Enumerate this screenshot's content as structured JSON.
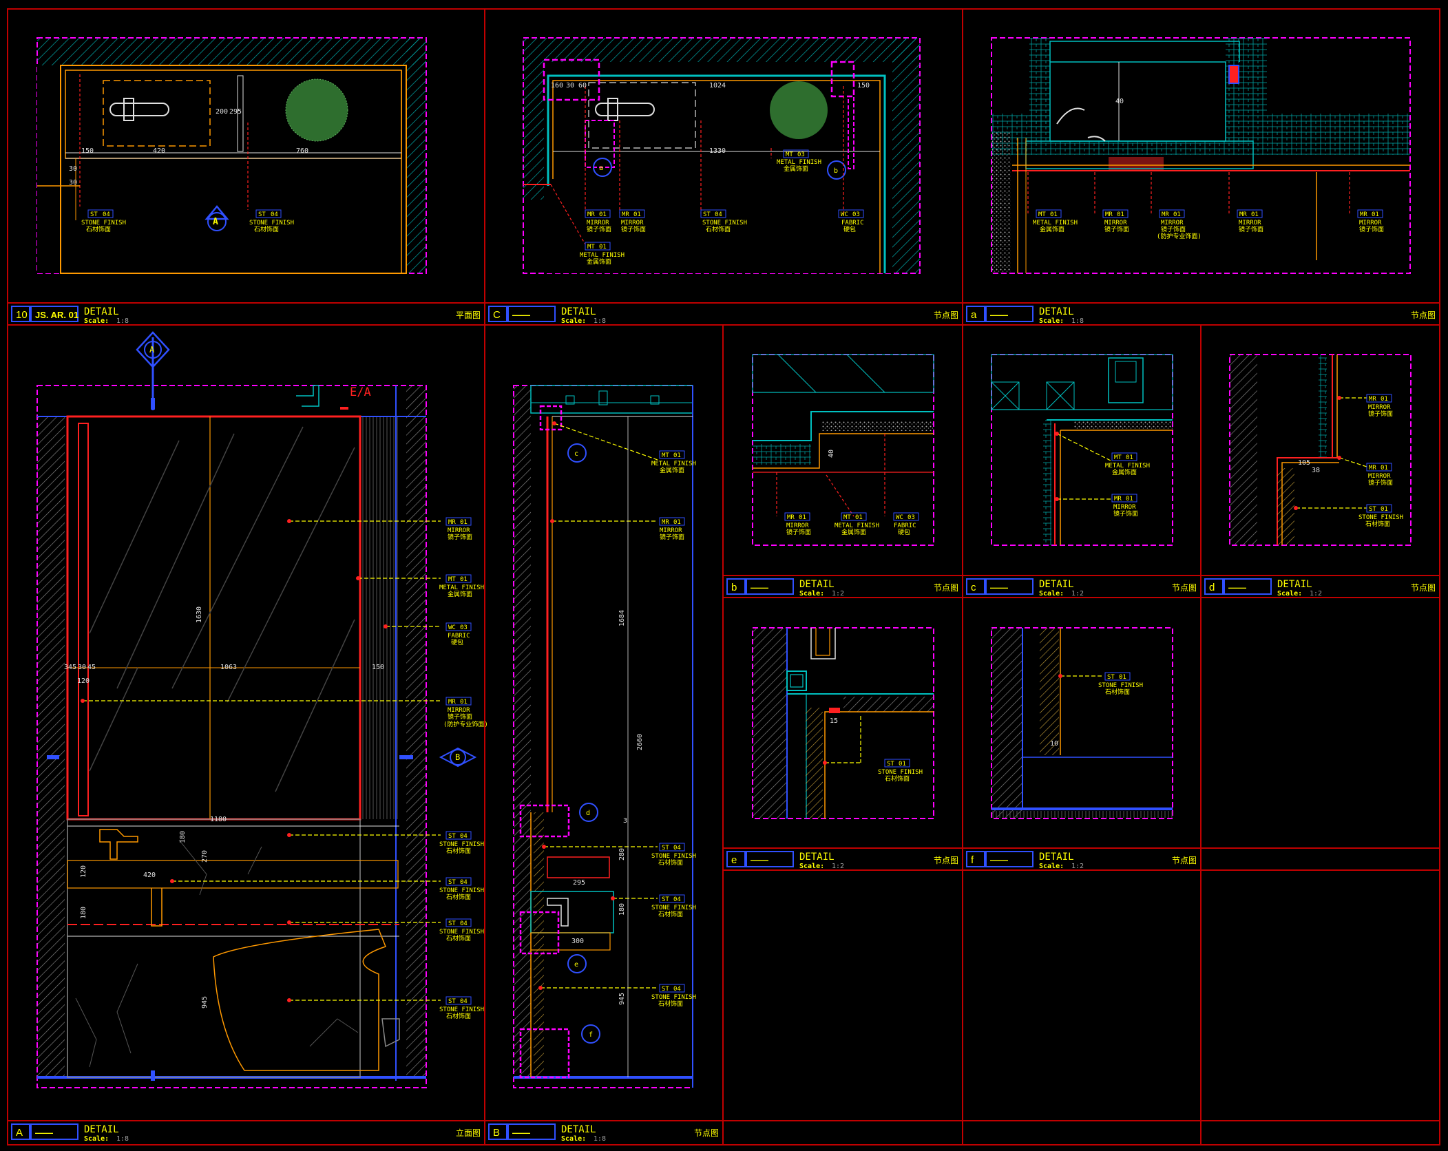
{
  "colors": {
    "frame": "#c00000",
    "magenta": "#ff00ff",
    "yellow": "#ffff00",
    "orange": "#ff9900",
    "cyan": "#00c0c0",
    "blue": "#3050ff",
    "red": "#ff2020",
    "green": "#3a8a3a",
    "white": "#e0e0e0",
    "grey": "#707070"
  },
  "title_blocks": [
    {
      "id": "10",
      "ref": "JS. AR. 01",
      "title": "DETAIL",
      "scale_prefix": "Scale:",
      "scale": "1:8",
      "type": "平面图"
    },
    {
      "id": "C",
      "ref": "——",
      "title": "DETAIL",
      "scale_prefix": "Scale:",
      "scale": "1:8",
      "type": "节点图"
    },
    {
      "id": "a",
      "ref": "——",
      "title": "DETAIL",
      "scale_prefix": "Scale:",
      "scale": "1:8",
      "type": "节点图"
    },
    {
      "id": "A",
      "ref": "——",
      "title": "DETAIL",
      "scale_prefix": "Scale:",
      "scale": "1:8",
      "type": "立面图"
    },
    {
      "id": "B",
      "ref": "——",
      "title": "DETAIL",
      "scale_prefix": "Scale:",
      "scale": "1:8",
      "type": "节点图"
    },
    {
      "id": "b",
      "ref": "——",
      "title": "DETAIL",
      "scale_prefix": "Scale:",
      "scale": "1:2",
      "type": "节点图"
    },
    {
      "id": "c",
      "ref": "——",
      "title": "DETAIL",
      "scale_prefix": "Scale:",
      "scale": "1:2",
      "type": "节点图"
    },
    {
      "id": "d",
      "ref": "——",
      "title": "DETAIL",
      "scale_prefix": "Scale:",
      "scale": "1:2",
      "type": "节点图"
    },
    {
      "id": "e",
      "ref": "——",
      "title": "DETAIL",
      "scale_prefix": "Scale:",
      "scale": "1:2",
      "type": "节点图"
    },
    {
      "id": "f",
      "ref": "——",
      "title": "DETAIL",
      "scale_prefix": "Scale:",
      "scale": "1:2",
      "type": "节点图"
    }
  ],
  "materials": {
    "st04": {
      "code": "ST",
      "num": "04",
      "en": "STONE FINISH",
      "cn": "石材饰面"
    },
    "st01": {
      "code": "ST",
      "num": "01",
      "en": "STONE FINISH",
      "cn": "石材饰面"
    },
    "mr01": {
      "code": "MR",
      "num": "01",
      "en": "MIRROR",
      "cn": "镜子饰面"
    },
    "mr01b": {
      "code": "MR",
      "num": "01",
      "en": "MIRROR",
      "cn": "镜子饰面",
      "note": "(防护专业饰面)"
    },
    "mt01": {
      "code": "MT",
      "num": "01",
      "en": "METAL FINISH",
      "cn": "金属饰面"
    },
    "mt03": {
      "code": "MT",
      "num": "03",
      "en": "METAL FINISH",
      "cn": "金属饰面"
    },
    "wc03": {
      "code": "WC",
      "num": "03",
      "en": "FABRIC",
      "cn": "硬包"
    }
  },
  "markers": {
    "section_A": "A",
    "section_B": "B",
    "elev_ea": "E/A",
    "callouts": [
      "a",
      "b",
      "c",
      "d",
      "e",
      "f"
    ]
  },
  "dims": {
    "p1": [
      "150",
      "420",
      "760",
      "30",
      "295",
      "200",
      "30"
    ],
    "p2": [
      "1024",
      "1330",
      "160",
      "30",
      "60",
      "150"
    ],
    "pa": [
      "40"
    ],
    "pA": [
      "1630",
      "1063",
      "345",
      "30",
      "45",
      "150",
      "120",
      "420",
      "180",
      "180",
      "120",
      "945",
      "1180",
      "270"
    ],
    "pB": [
      "1684",
      "2660",
      "280",
      "295",
      "180",
      "300",
      "945",
      "3"
    ],
    "pb": [
      "40"
    ],
    "pd": [
      "105",
      "38"
    ],
    "pe": [
      "15"
    ],
    "pf": [
      "10"
    ]
  }
}
